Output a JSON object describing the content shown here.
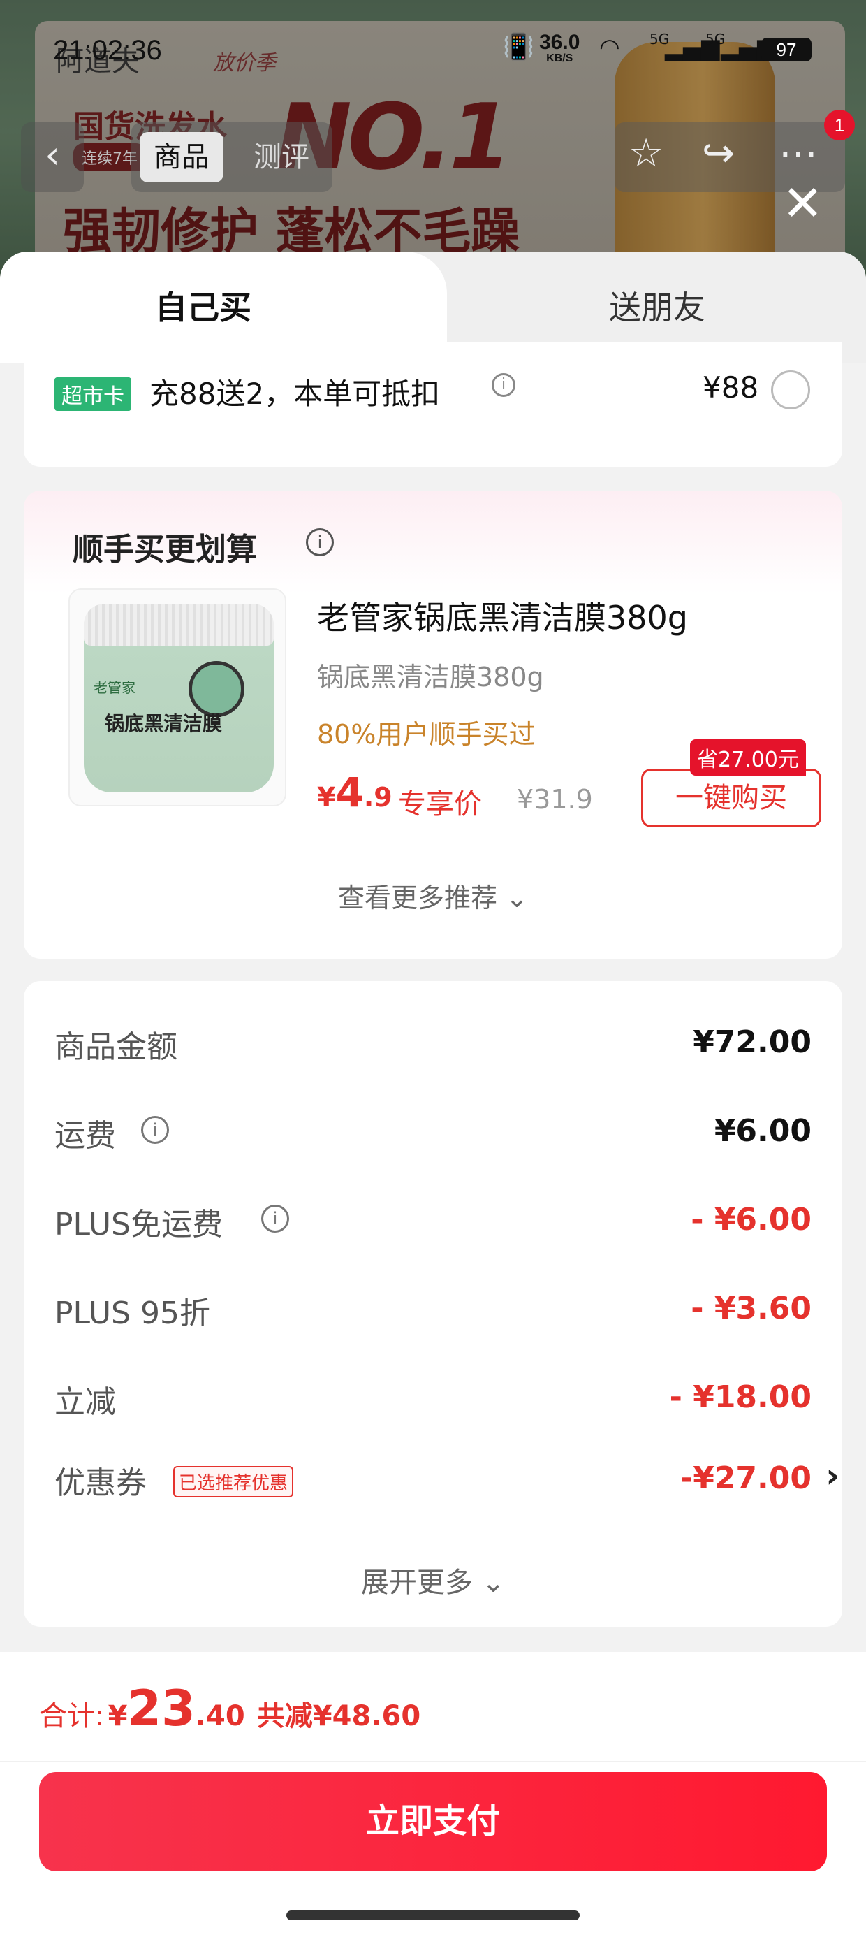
{
  "status_bar": {
    "time": "21:02:36",
    "net_speed": "36.0",
    "net_unit": "KB/S",
    "sig1": "5G",
    "sig2": "5G",
    "battery": "97"
  },
  "banner": {
    "brand": "阿道夫",
    "brand_tag": "放价季",
    "slogan1": "国货洗发水",
    "streak": "连续7年",
    "rank": "NO.1",
    "slogan2": "强韧修护 蓬松不毛躁"
  },
  "nav": {
    "back": "‹",
    "tab_product": "商品",
    "tab_review": "测评",
    "badge_count": "1",
    "close": "✕"
  },
  "purchase_tabs": {
    "self": "自己买",
    "friend": "送朋友"
  },
  "top_card": {
    "card_label": "超市卡",
    "desc": "充88送2，本单可抵扣",
    "info": "i",
    "amount": "¥88"
  },
  "bundle": {
    "title": "顺手买更划算",
    "info": "i",
    "jar_brand": "老管家",
    "jar_label": "锅底黑清洁膜",
    "product_title": "老管家锅底黑清洁膜380g",
    "product_sub": "锅底黑清洁膜380g",
    "bought_note": "80%用户顺手买过",
    "price_cur": "¥",
    "price_int": "4",
    "price_dec": ".9",
    "exclusive_label": "专享价",
    "orig_price": "¥31.9",
    "save_tag": "省27.00元",
    "buy_button": "一键购买",
    "more_rec": "查看更多推荐 ⌄"
  },
  "summary": {
    "rows": [
      {
        "label": "商品金额",
        "value": "¥72.00"
      },
      {
        "label": "运费",
        "value": "¥6.00"
      },
      {
        "label": "PLUS免运费",
        "value": "- ¥6.00"
      },
      {
        "label": "PLUS 95折",
        "value": "- ¥3.60"
      },
      {
        "label": "立减",
        "value": "- ¥18.00"
      },
      {
        "label": "优惠券",
        "value": "-¥27.00",
        "tag": "已选推荐优惠"
      }
    ],
    "info": "i",
    "chevron": "›",
    "expand": "展开更多 ⌄"
  },
  "footer": {
    "total_label": "合计:",
    "total_cur": "¥",
    "total_int": "23",
    "total_dec": ".40",
    "saved": "共减¥48.60",
    "pay_button": "立即支付"
  },
  "colors": {
    "accent_red": "#e5322d",
    "pay_button": "#ff1930",
    "card_label_green": "#2cb574",
    "bought_orange": "#c9832a"
  }
}
